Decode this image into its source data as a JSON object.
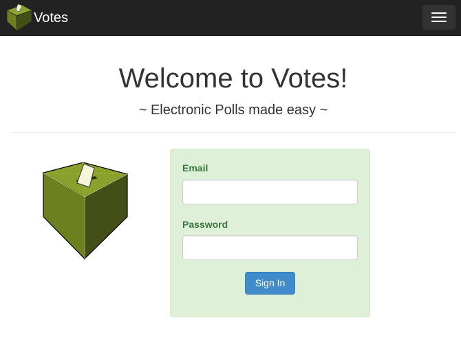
{
  "navbar": {
    "brand_label": "Votes",
    "logo_icon": "ballot-box-icon",
    "menu_icon": "hamburger-menu-icon"
  },
  "header": {
    "title": "Welcome to Votes!",
    "subtitle": "~ Electronic Polls made easy ~"
  },
  "login": {
    "email_label": "Email",
    "email_value": "",
    "password_label": "Password",
    "password_value": "",
    "submit_label": "Sign In"
  },
  "colors": {
    "navbar_bg": "#222222",
    "panel_bg": "#dff0d8",
    "label_green": "#3c763d",
    "primary_button": "#428bca",
    "box_light": "#8aa22c",
    "box_dark": "#434f16"
  }
}
